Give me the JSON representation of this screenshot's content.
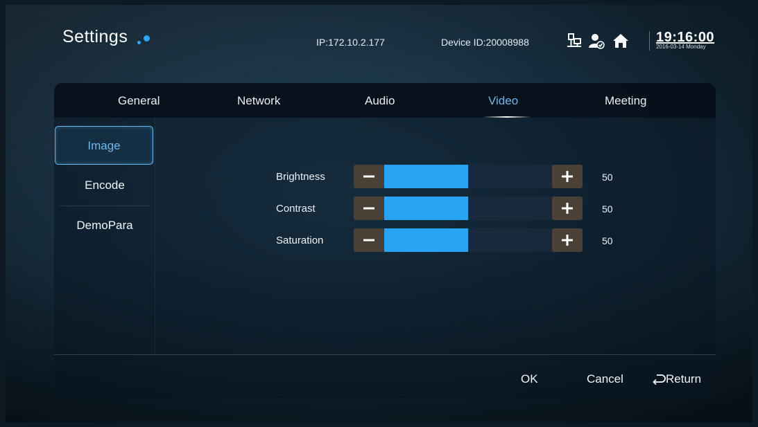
{
  "header": {
    "title": "Settings",
    "ip": "IP:172.10.2.177",
    "device_id": "Device ID:20008988",
    "icons": [
      "network-icon",
      "user-status-icon",
      "home-icon"
    ],
    "time": "19:16:00",
    "date": "2016-03-14 Monday"
  },
  "tabs": [
    {
      "label": "General",
      "active": false
    },
    {
      "label": "Network",
      "active": false
    },
    {
      "label": "Audio",
      "active": false
    },
    {
      "label": "Video",
      "active": true
    },
    {
      "label": "Meeting",
      "active": false
    }
  ],
  "sidebar": {
    "items": [
      {
        "label": "Image",
        "active": true
      },
      {
        "label": "Encode",
        "active": false
      },
      {
        "label": "DemoPara",
        "active": false
      }
    ]
  },
  "sliders": [
    {
      "label": "Brightness",
      "value": "50",
      "fraction": 0.5
    },
    {
      "label": "Contrast",
      "value": "50",
      "fraction": 0.5
    },
    {
      "label": "Saturation",
      "value": "50",
      "fraction": 0.5
    }
  ],
  "footer": {
    "ok_label": "OK",
    "cancel_label": "Cancel",
    "return_label": "Return"
  },
  "colors": {
    "accent": "#29a3f4",
    "active_text": "#6fb8ee",
    "stepper_button": "#4a4036"
  }
}
